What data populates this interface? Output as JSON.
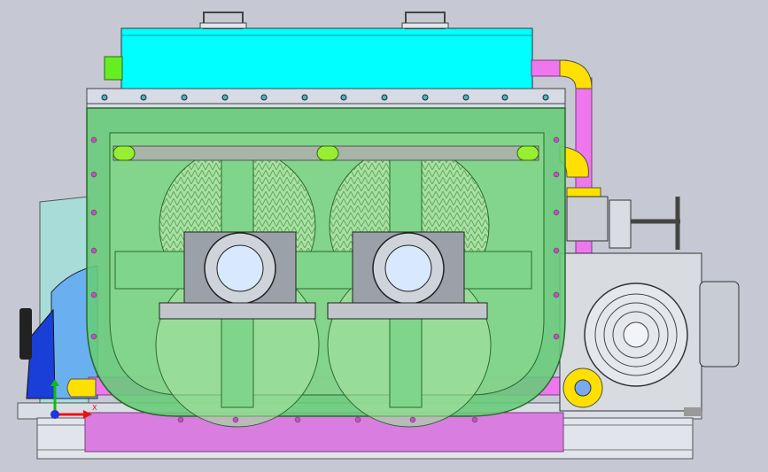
{
  "viewport": {
    "background": "#c6c9d3",
    "colors": {
      "hopper": "#00ffff",
      "trough": "#66cc77",
      "pipe_magenta": "#ee77ee",
      "pipe_yellow": "#ffe000",
      "nozzle_green": "#66ee22",
      "motor_gray": "#d8dbe0",
      "axis_x": "#ee1111",
      "axis_y": "#11bb11",
      "origin": "#2233dd"
    },
    "icons": {
      "triad": "axis-triad-icon",
      "handles": "lifting-handle-icon",
      "valve": "handwheel-valve-icon"
    },
    "triad_label": "X"
  }
}
